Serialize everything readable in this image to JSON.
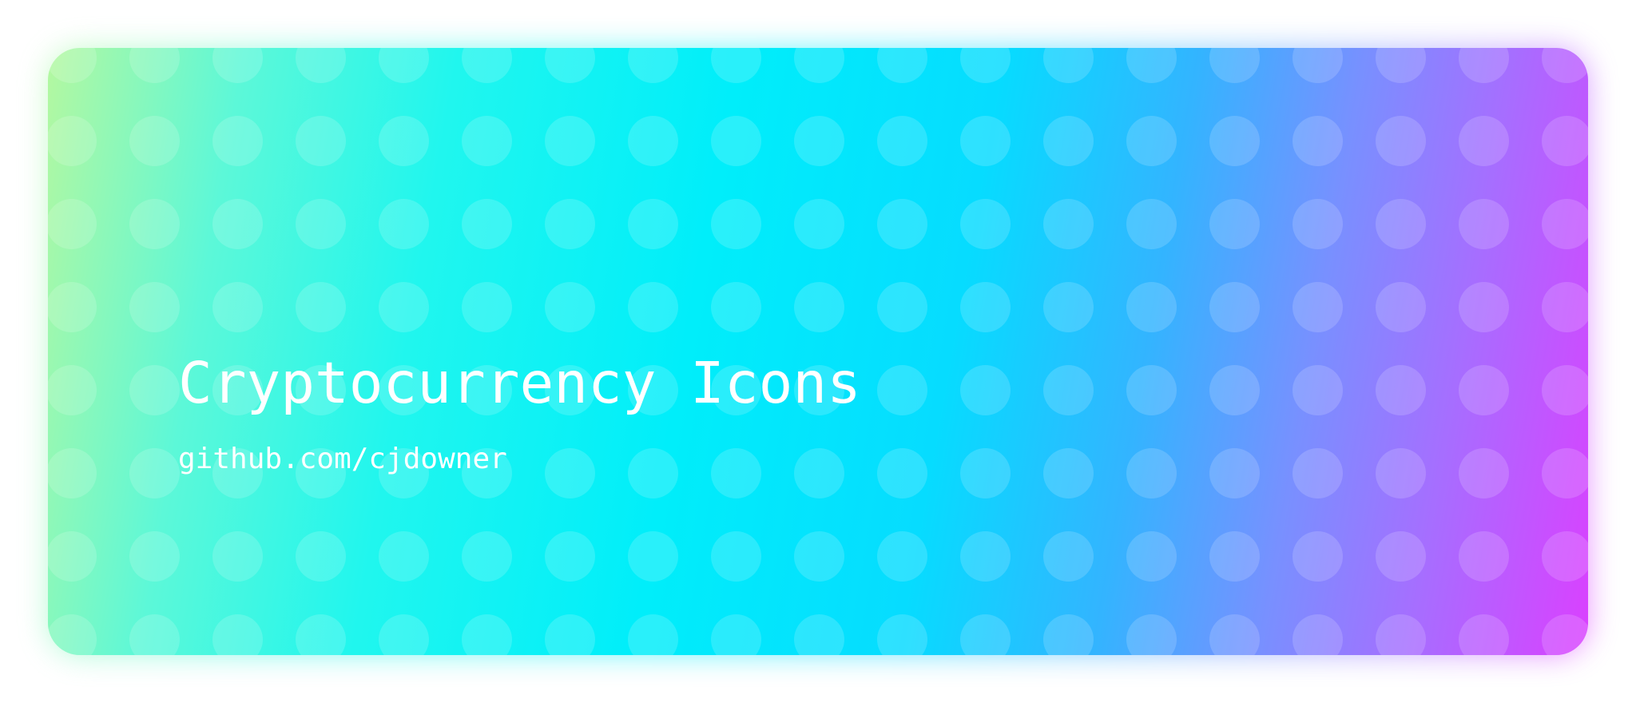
{
  "banner": {
    "title": "Cryptocurrency Icons",
    "subtitle": "github.com/cjdowner"
  },
  "colors": {
    "gradient": [
      "#b4f8a0",
      "#00eefa",
      "#33b4ff",
      "#a66eff",
      "#da40ff"
    ],
    "text": "#ffffff"
  },
  "icon_grid": {
    "columns": 19,
    "rows": 8,
    "icon": "coin-icon"
  }
}
